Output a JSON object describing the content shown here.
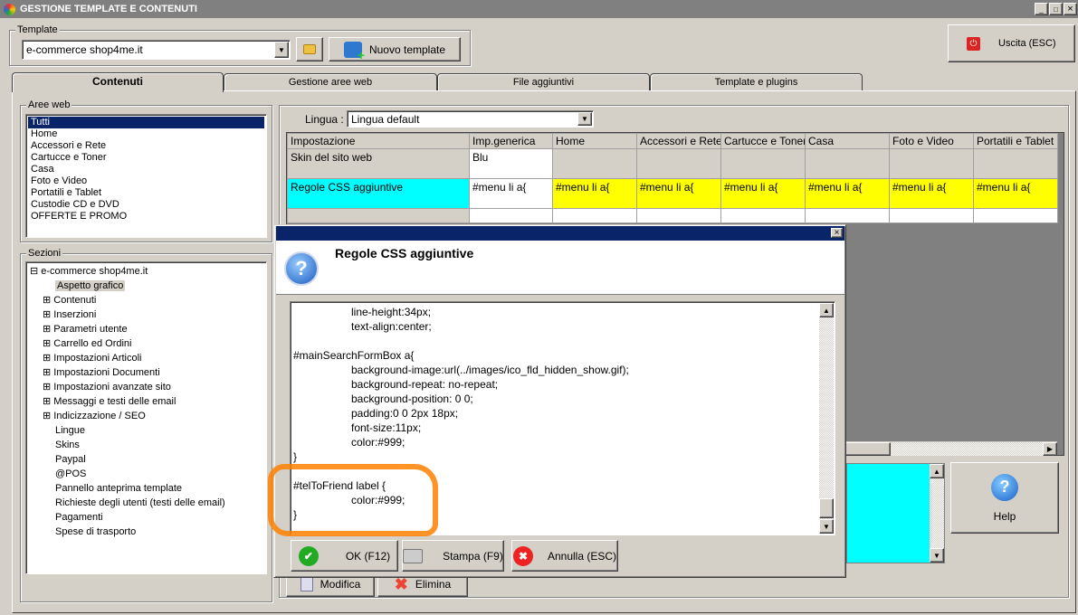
{
  "window": {
    "title": "GESTIONE TEMPLATE E CONTENUTI",
    "controls": [
      "_",
      "□",
      "×"
    ]
  },
  "template": {
    "group_label": "Template",
    "selected": "e-commerce shop4me.it",
    "new_label": "Nuovo template"
  },
  "exit_label": "Uscita (ESC)",
  "tabs": [
    {
      "label": "Contenuti",
      "active": true
    },
    {
      "label": "Gestione aree web"
    },
    {
      "label": "File aggiuntivi"
    },
    {
      "label": "Template e plugins"
    }
  ],
  "aree_web": {
    "label": "Aree web",
    "items": [
      "Tutti",
      "Home",
      "Accessori e Rete",
      "Cartucce e Toner",
      "Casa",
      "Foto e Video",
      "Portatili e Tablet",
      "Custodie CD e DVD",
      "OFFERTE E PROMO"
    ],
    "selected": 0
  },
  "sezioni": {
    "label": "Sezioni",
    "root": "e-commerce shop4me.it",
    "items": [
      {
        "label": "Aspetto grafico",
        "expandable": false,
        "selected": true
      },
      {
        "label": "Contenuti",
        "expandable": true
      },
      {
        "label": "Inserzioni",
        "expandable": true
      },
      {
        "label": "Parametri utente",
        "expandable": true
      },
      {
        "label": "Carrello ed Ordini",
        "expandable": true
      },
      {
        "label": "Impostazioni Articoli",
        "expandable": true
      },
      {
        "label": "Impostazioni Documenti",
        "expandable": true
      },
      {
        "label": "Impostazioni avanzate sito",
        "expandable": true
      },
      {
        "label": "Messaggi e testi delle email",
        "expandable": true
      },
      {
        "label": "Indicizzazione / SEO",
        "expandable": true
      },
      {
        "label": "Lingue"
      },
      {
        "label": "Skins"
      },
      {
        "label": "Paypal"
      },
      {
        "label": "@POS"
      },
      {
        "label": "Pannello anteprima template"
      },
      {
        "label": "Richieste degli utenti (testi delle email)"
      },
      {
        "label": "Pagamenti"
      },
      {
        "label": "Spese di trasporto"
      }
    ]
  },
  "lingua": {
    "label": "Lingua :",
    "selected": "Lingua default"
  },
  "grid": {
    "columns": [
      "Impostazione",
      "Imp.generica",
      "Home",
      "Accessori e Rete",
      "Cartucce e Toner",
      "Casa",
      "Foto e Video",
      "Portatili e Tablet"
    ],
    "rows": [
      [
        "Skin del sito web",
        "Blu",
        "",
        "",
        "",
        "",
        "",
        ""
      ],
      [
        "Regole CSS aggiuntive",
        "#menu li a{",
        "#menu li a{",
        "#menu li a{",
        "#menu li a{",
        "#menu li a{",
        "#menu li a{",
        "#menu li a{"
      ],
      [
        "",
        "",
        "",
        "",
        "",
        "",
        "",
        ""
      ]
    ]
  },
  "buttons": {
    "help": "Help",
    "modifica": "Modifica",
    "elimina": "Elimina"
  },
  "dialog": {
    "title": "Regole CSS aggiuntive",
    "close": "×",
    "lines": [
      "\t\tline-height:34px;",
      "\t\ttext-align:center;",
      "",
      "#mainSearchFormBox a{",
      "\t\tbackground-image:url(../images/ico_fld_hidden_show.gif);",
      "\t\tbackground-repeat: no-repeat;",
      "\t\tbackground-position: 0 0;",
      "\t\tpadding:0 0 2px 18px;",
      "\t\tfont-size:11px;",
      "\t\tcolor:#999;",
      "}",
      "",
      "#telToFriend label {",
      "\t\tcolor:#999;",
      "}"
    ],
    "ok": "OK (F12)",
    "print": "Stampa (F9)",
    "cancel": "Annulla (ESC)"
  },
  "colors": {
    "titlebar": "#808080",
    "dialog_titlebar": "#0a246a",
    "highlight_cyan": "#00ffff",
    "highlight_yellow": "#ffff00",
    "annotation": "#ff8000"
  }
}
